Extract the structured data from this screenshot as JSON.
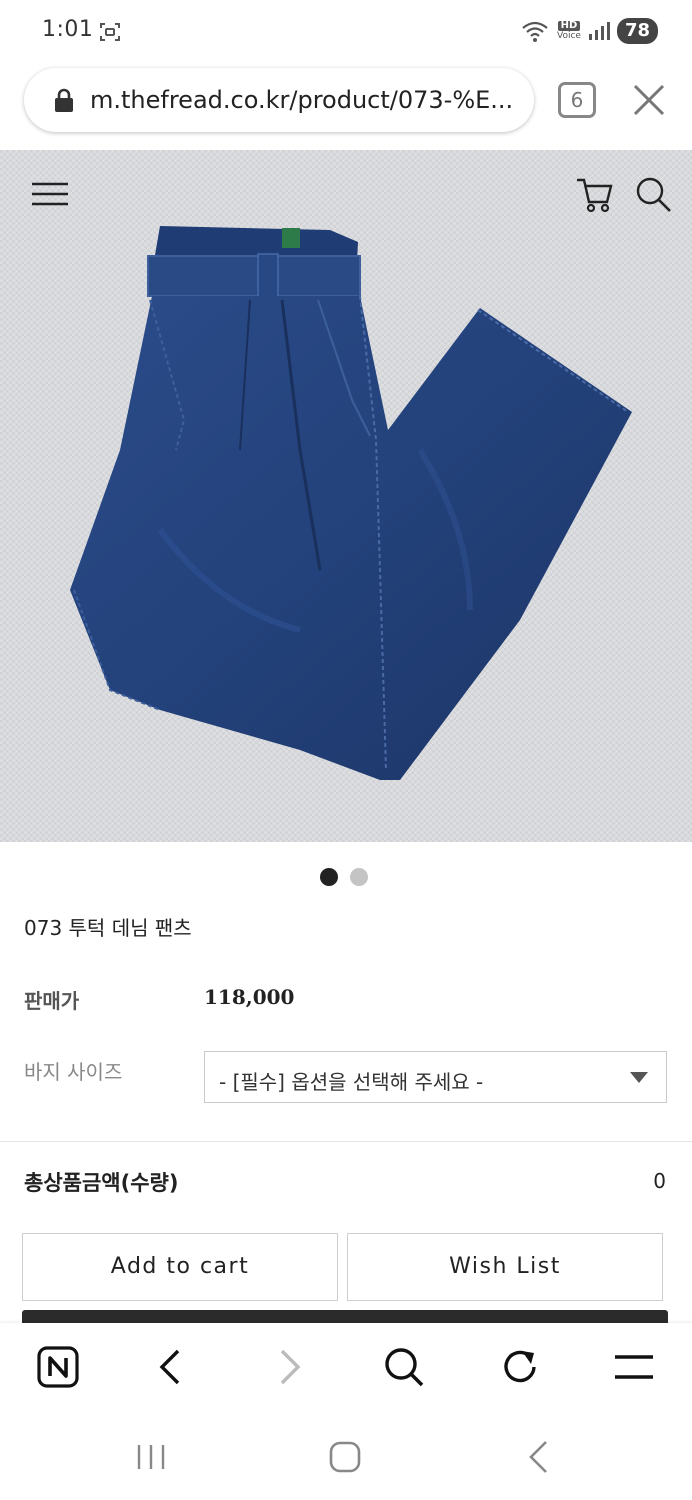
{
  "status_bar": {
    "time": "1:01",
    "network_badge": "HD",
    "network_sub": "Voice",
    "battery": "78",
    "icons": [
      "screenshot-icon",
      "wifi-icon",
      "signal-icon"
    ]
  },
  "browser": {
    "url": "m.thefread.co.kr/product/073-%E...",
    "tab_count": "6",
    "icons": [
      "lock-icon",
      "close-icon"
    ]
  },
  "site_header": {
    "icons": [
      "menu-icon",
      "cart-icon",
      "search-icon"
    ]
  },
  "carousel": {
    "slides": 2,
    "active_index": 0
  },
  "product": {
    "name": "073 투턱 데님 팬츠",
    "price_label": "판매가",
    "price": "118,000",
    "size_label": "바지 사이즈",
    "size_placeholder": "- [필수] 옵션을 선택해 주세요 -",
    "total_label": "총상품금액(수량)",
    "total_value": "0"
  },
  "actions": {
    "add_to_cart": "Add to cart",
    "wish_list": "Wish List"
  },
  "colors": {
    "denim": "#23417a",
    "background_fabric": "#d9dadd",
    "buy_button": "#2b2b2b"
  },
  "browser_toolbar": {
    "icons": [
      "naver-icon",
      "back-icon",
      "forward-icon",
      "search-icon",
      "refresh-icon",
      "menu-icon"
    ]
  },
  "system_nav": {
    "icons": [
      "recent-apps-icon",
      "home-icon",
      "back-icon"
    ]
  }
}
